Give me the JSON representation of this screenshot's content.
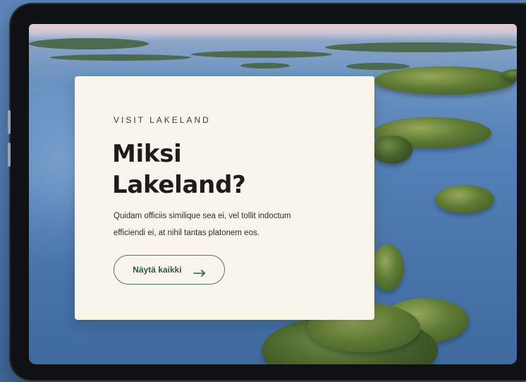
{
  "hero": {
    "eyebrow": "VISIT LAKELAND",
    "title_line1": "Miksi",
    "title_line2": "Lakeland?",
    "body_line1": "Quidam officiis similique sea ei, vel tollit indoctum",
    "body_line2": "efficiendi ei, at nihil tantas platonem eos.",
    "cta_label": "Näytä kaikki",
    "cta_icon": "arrow-right-icon"
  },
  "colors": {
    "card_background": "#faf5ec",
    "accent_green": "#2f5a3a",
    "device_frame": "#0f1114",
    "lake_blue": "#4c78ae"
  }
}
